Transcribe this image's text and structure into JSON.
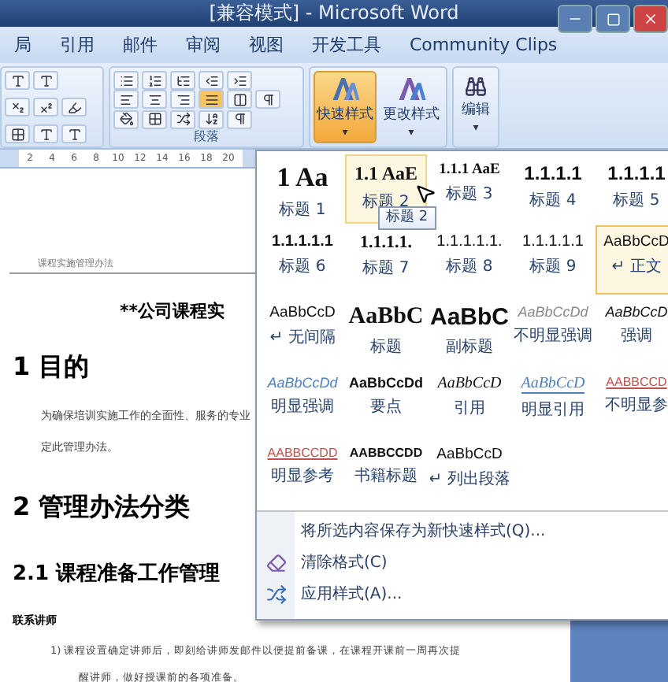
{
  "window": {
    "title": "[兼容模式] - Microsoft Word"
  },
  "tabs": [
    {
      "label": "局",
      "selected": false
    },
    {
      "label": "引用",
      "selected": false
    },
    {
      "label": "邮件",
      "selected": false
    },
    {
      "label": "审阅",
      "selected": false
    },
    {
      "label": "视图",
      "selected": false
    },
    {
      "label": "开发工具",
      "selected": false
    },
    {
      "label": "Community Clips",
      "selected": false
    }
  ],
  "ribbon": {
    "paragraph_group": "段落",
    "style_buttons": [
      {
        "label": "快速样式",
        "caret": "▾",
        "active": true
      },
      {
        "label": "更改样式",
        "caret": "▾",
        "active": false
      }
    ],
    "edit_button": {
      "label": "编辑",
      "caret": "▾"
    },
    "ruler": [
      "2",
      "4",
      "6",
      "8",
      "10",
      "12",
      "14",
      "16",
      "18",
      "20"
    ]
  },
  "document": {
    "header": "课程实施管理办法",
    "title": "**公司课程实",
    "blocks": [
      {
        "kind": "h1",
        "text": "1  目的"
      },
      {
        "kind": "body",
        "text": "为确保培训实施工作的全面性、服务的专业"
      },
      {
        "kind": "body",
        "text": "定此管理办法。"
      },
      {
        "kind": "h1",
        "text": "2  管理办法分类"
      },
      {
        "kind": "h2",
        "text": "2.1 课程准备工作管理"
      },
      {
        "kind": "bold",
        "text": "联系讲师"
      },
      {
        "kind": "list",
        "text": "1) 课程设置确定讲师后，即刻给讲师发邮件以便提前备课，在课程开课前一周再次提"
      },
      {
        "kind": "cont",
        "text": "醒讲师，做好授课前的各项准备。"
      }
    ]
  },
  "styles_gallery": {
    "styles": [
      {
        "preview": "1  Aa",
        "label": "标题 1",
        "kind": "h1",
        "selected": false,
        "hovered": false
      },
      {
        "preview": "1.1 AaE",
        "label": "标题 2",
        "kind": "h2",
        "selected": false,
        "hovered": true
      },
      {
        "preview": "1.1.1 AaE",
        "label": "标题 3",
        "kind": "h3",
        "selected": false,
        "hovered": false
      },
      {
        "preview": "1.1.1.1",
        "label": "标题 4",
        "kind": "h4",
        "selected": false,
        "hovered": false
      },
      {
        "preview": "1.1.1.1",
        "label": "标题 5",
        "kind": "h4",
        "selected": false,
        "hovered": false
      },
      {
        "preview": "1.1.1.1.1",
        "label": "标题 6",
        "kind": "num",
        "selected": false,
        "hovered": false
      },
      {
        "preview": "1.1.1.1.",
        "label": "标题 7",
        "kind": "numserif",
        "selected": false,
        "hovered": false
      },
      {
        "preview": "1.1.1.1.1.",
        "label": "标题 8",
        "kind": "numlight",
        "selected": false,
        "hovered": false
      },
      {
        "preview": "1.1.1.1.1",
        "label": "标题 9",
        "kind": "numlight",
        "selected": false,
        "hovered": false
      },
      {
        "preview": "AaBbCcD",
        "label": "正文",
        "mark": "↵",
        "kind": "normal",
        "selected": true,
        "hovered": false
      },
      {
        "preview": "AaBbCcD",
        "label": "无间隔",
        "mark": "↵",
        "kind": "normal",
        "selected": false,
        "hovered": false
      },
      {
        "preview": "AaBbC",
        "label": "标题",
        "kind": "title",
        "selected": false,
        "hovered": false
      },
      {
        "preview": "AaBbC",
        "label": "副标题",
        "kind": "subtitle",
        "selected": false,
        "hovered": false
      },
      {
        "preview": "AaBbCcDd",
        "label": "不明显强调",
        "kind": "subtle",
        "selected": false,
        "hovered": false
      },
      {
        "preview": "AaBbCcD",
        "label": "强调",
        "kind": "emphasis",
        "selected": false,
        "hovered": false
      },
      {
        "preview": "AaBbCcDd",
        "label": "明显强调",
        "kind": "intense",
        "selected": false,
        "hovered": false
      },
      {
        "preview": "AaBbCcDd",
        "label": "要点",
        "kind": "strong",
        "selected": false,
        "hovered": false
      },
      {
        "preview": "AaBbCcD",
        "label": "引用",
        "kind": "quote",
        "selected": false,
        "hovered": false
      },
      {
        "preview": "AaBbCcD",
        "label": "明显引用",
        "kind": "intensequote",
        "selected": false,
        "hovered": false
      },
      {
        "preview": "AABBCCD",
        "label": "不明显参",
        "kind": "subtleref",
        "selected": false,
        "hovered": false
      },
      {
        "preview": "AABBCCDD",
        "label": "明显参考",
        "kind": "intenseref",
        "selected": false,
        "hovered": false
      },
      {
        "preview": "AABBCCDD",
        "label": "书籍标题",
        "kind": "book",
        "selected": false,
        "hovered": false
      },
      {
        "preview": "AaBbCcD",
        "label": "列出段落",
        "mark": "↵",
        "kind": "normal",
        "selected": false,
        "hovered": false
      }
    ],
    "tooltip": "标题 2",
    "menu": [
      {
        "label": "将所选内容保存为新快速样式(Q)...",
        "kind": "plain"
      },
      {
        "label": "清除格式(C)",
        "kind": "clear"
      },
      {
        "label": "应用样式(A)...",
        "kind": "apply"
      }
    ]
  }
}
